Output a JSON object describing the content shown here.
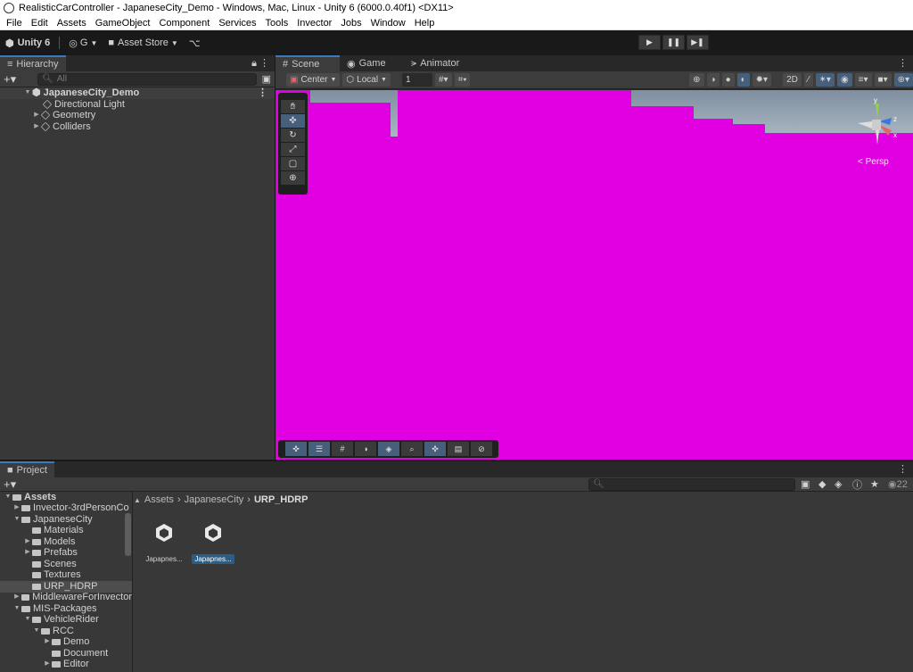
{
  "window": {
    "title": "RealisticCarController - JapaneseCity_Demo - Windows, Mac, Linux - Unity 6 (6000.0.40f1) <DX11>"
  },
  "menu": [
    "File",
    "Edit",
    "Assets",
    "GameObject",
    "Component",
    "Services",
    "Tools",
    "Invector",
    "Jobs",
    "Window",
    "Help"
  ],
  "toolbar": {
    "unity_label": "Unity 6",
    "account_label": "G",
    "asset_store_label": "Asset Store"
  },
  "hierarchy": {
    "tab_label": "Hierarchy",
    "search_placeholder": "All",
    "root": "JapaneseCity_Demo",
    "children": [
      "Directional Light",
      "Geometry",
      "Colliders"
    ]
  },
  "scene": {
    "tabs": [
      "Scene",
      "Game",
      "Animator"
    ],
    "pivot_label": "Center",
    "space_label": "Local",
    "grid_snap_value": "1",
    "gizmo_labels": {
      "y": "y",
      "z": "z",
      "x": "x"
    },
    "persp_label": "< Persp",
    "fill_color": "#e100e1"
  },
  "project": {
    "tab_label": "Project",
    "hidden_count": "22",
    "tree": [
      "Assets",
      "Invector-3rdPersonCo",
      "JapaneseCity",
      "Materials",
      "Models",
      "Prefabs",
      "Scenes",
      "Textures",
      "URP_HDRP",
      "MiddlewareForInvector",
      "MIS-Packages",
      "VehicleRider",
      "RCC",
      "Demo",
      "Document",
      "Editor"
    ],
    "breadcrumb": {
      "a": "Assets",
      "b": "JapaneseCity",
      "c": "URP_HDRP"
    },
    "assets": [
      "Japapnes...",
      "Japapnes..."
    ]
  }
}
